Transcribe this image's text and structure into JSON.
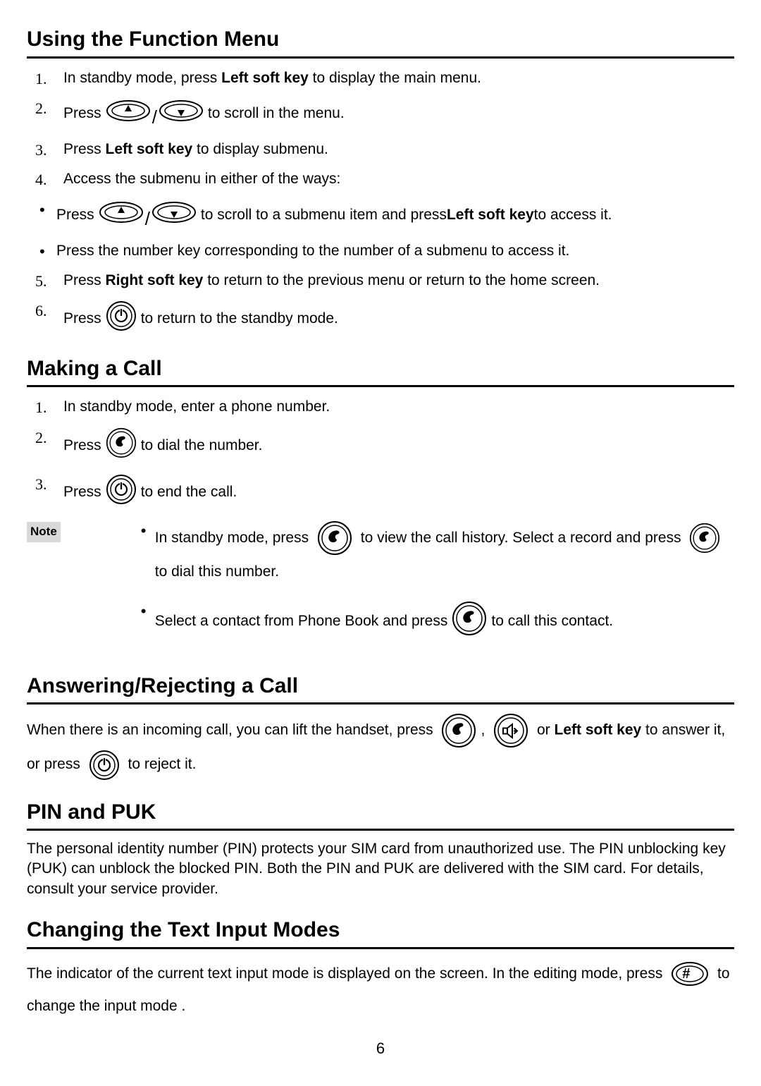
{
  "page_number": "6",
  "icons": {
    "up": "▲",
    "down": "▼",
    "power": "⏻",
    "call": "✆",
    "speaker": "🔇",
    "hash": "#"
  },
  "sections": {
    "function_menu": {
      "title": "Using the Function Menu",
      "items": [
        {
          "n": "1.",
          "pre": "In standby mode, press ",
          "b": "Left soft key",
          "post": " to display the main menu."
        },
        {
          "n": "2.",
          "pre": "Press ",
          "post": " to scroll in the menu.",
          "icon": "updown"
        },
        {
          "n": "3.",
          "pre": "Press ",
          "b": "Left soft key",
          "post": " to display submenu."
        },
        {
          "n": "4.",
          "pre": "Access the submenu in either of the ways:"
        }
      ],
      "bullets": [
        {
          "pre": "Press ",
          "mid": " to scroll to a submenu item and press ",
          "b": "Left soft key",
          "post": " to access it.",
          "icon": "updown"
        },
        {
          "pre": "Press the number key corresponding to the number of a submenu to access it."
        }
      ],
      "items2": [
        {
          "n": "5.",
          "pre": "Press ",
          "b": "Right soft key",
          "post": " to return to the previous menu or return to the home screen."
        },
        {
          "n": "6.",
          "pre": "Press ",
          "post": " to return to the standby mode.",
          "icon": "power"
        }
      ]
    },
    "making_call": {
      "title": "Making a Call",
      "items": [
        {
          "n": "1.",
          "pre": "In standby mode, enter a phone number."
        },
        {
          "n": "2.",
          "pre": "Press ",
          "post": " to dial the number.",
          "icon": "call"
        },
        {
          "n": "3.",
          "pre": "Press ",
          "post": " to end the call.",
          "icon": "power"
        }
      ],
      "note_label": "Note",
      "note": [
        {
          "pre": "In standby mode, press ",
          "mid": " to view the call history. Select a record and press ",
          "post": " to dial this number."
        },
        {
          "pre": "Select a contact from Phone Book and press ",
          "post": " to call this contact."
        }
      ]
    },
    "answer": {
      "title": "Answering/Rejecting a Call",
      "para_pre": "When there is an incoming call, you can lift the handset, press",
      "para_mid1": ", ",
      "para_mid2": " or ",
      "b": "Left soft key",
      "para_mid3": " to answer it, or press ",
      "para_post": " to reject it."
    },
    "pin": {
      "title": "PIN and PUK",
      "para": "The personal identity number (PIN) protects your SIM card from unauthorized use. The PIN unblocking key (PUK) can unblock the blocked PIN. Both the PIN and PUK are delivered with the SIM card. For details, consult your service provider."
    },
    "input": {
      "title": "Changing the Text Input Modes",
      "para_pre": "The indicator of the current text input mode is displayed on the screen. In the editing mode, press ",
      "para_post": " to change the input mode ."
    }
  }
}
